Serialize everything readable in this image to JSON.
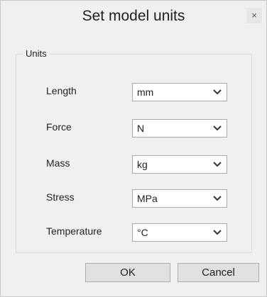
{
  "window": {
    "title": "Set model units",
    "close_label": "×"
  },
  "units_group": {
    "label": "Units",
    "rows": [
      {
        "label": "Length",
        "value": "mm"
      },
      {
        "label": "Force",
        "value": "N"
      },
      {
        "label": "Mass",
        "value": "kg"
      },
      {
        "label": "Stress",
        "value": "MPa"
      },
      {
        "label": "Temperature",
        "value": "°C"
      }
    ]
  },
  "buttons": {
    "ok": "OK",
    "cancel": "Cancel"
  },
  "icons": {
    "dropdown": "chevron-down-icon",
    "close": "close-icon"
  }
}
